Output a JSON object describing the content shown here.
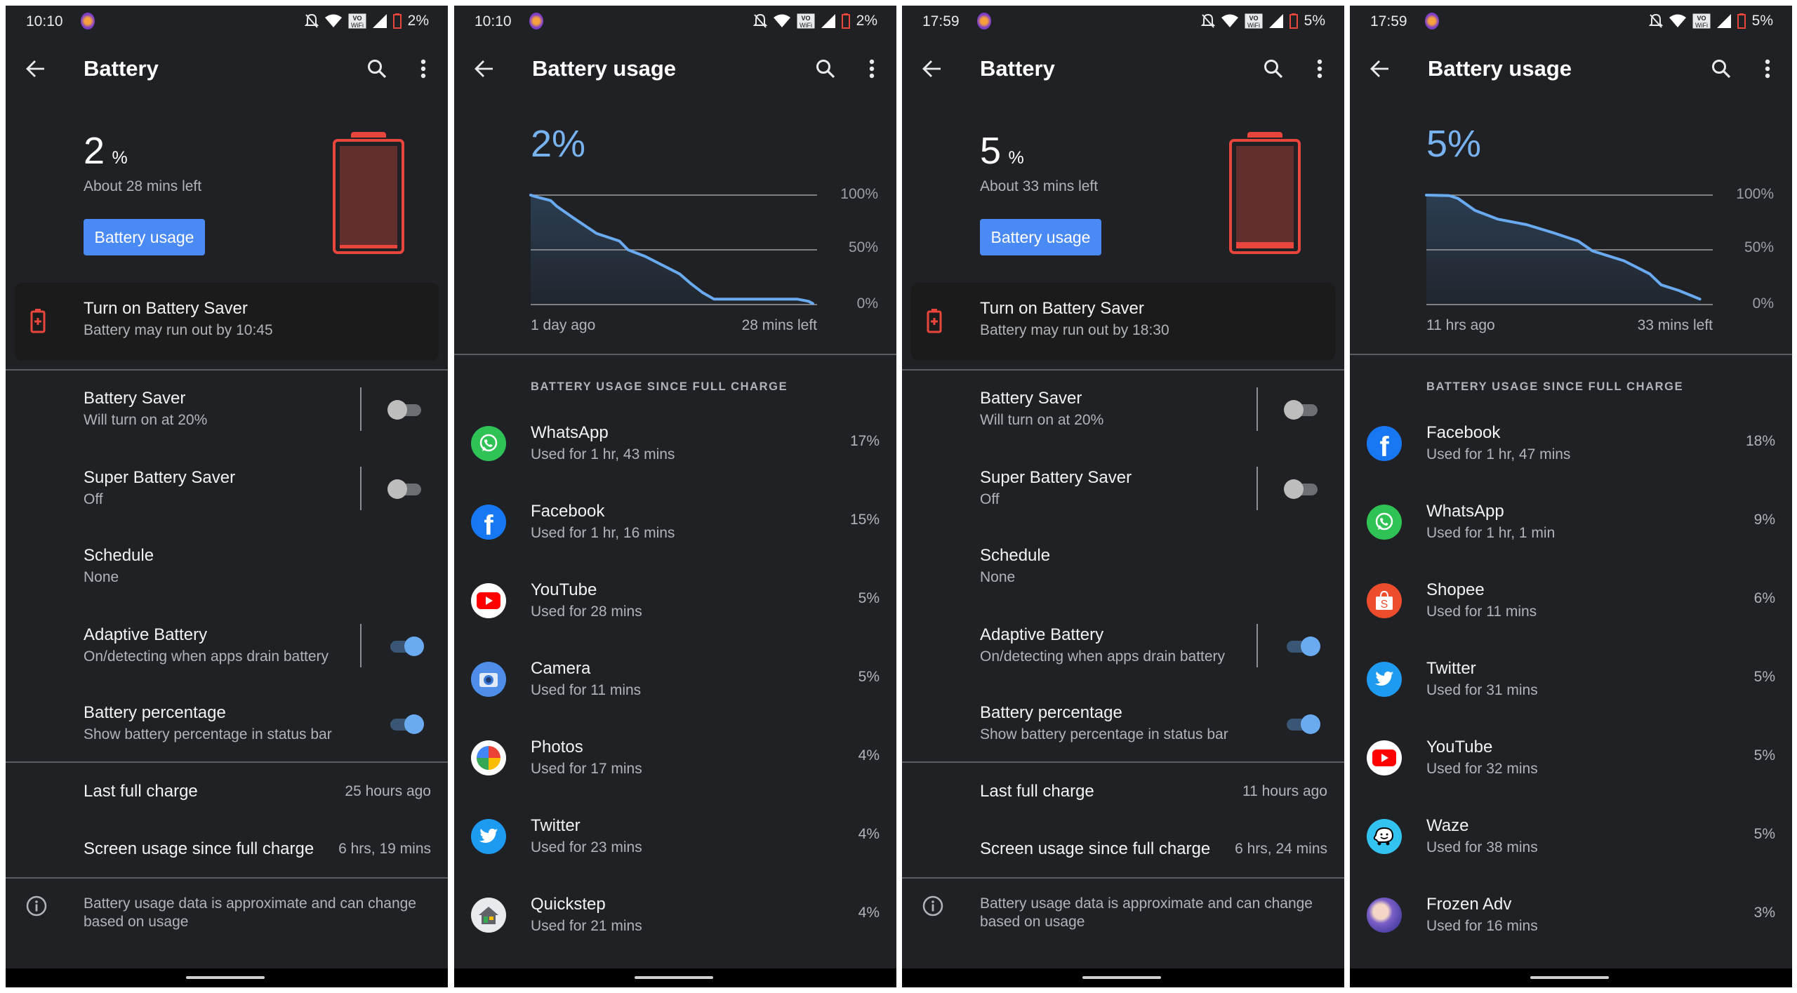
{
  "colors": {
    "background": "#202124",
    "accent_blue": "#4a8af4",
    "chart_line": "#6aaaf0",
    "battery_low_red": "#e8453c",
    "toggle_on_thumb": "#6aaaf0",
    "toggle_off_thumb": "#bdbdbd"
  },
  "screens": [
    {
      "type": "battery",
      "status": {
        "time": "10:10",
        "battery": "2%"
      },
      "header": {
        "title": "Battery"
      },
      "summary": {
        "level": "2",
        "unit": "%",
        "remaining": "About 28 mins left",
        "button": "Battery usage",
        "fill_percent": 2
      },
      "saver_card": {
        "title": "Turn on Battery Saver",
        "subtitle": "Battery may run out by 10:45"
      },
      "settings": [
        {
          "title": "Battery Saver",
          "subtitle": "Will turn on at 20%",
          "toggle": false,
          "divider": true
        },
        {
          "title": "Super Battery Saver",
          "subtitle": "Off",
          "toggle": false,
          "divider": true
        },
        {
          "title": "Schedule",
          "subtitle": "None",
          "toggle": null,
          "divider": false
        },
        {
          "title": "Adaptive Battery",
          "subtitle": "On/detecting when apps drain battery",
          "toggle": true,
          "divider": true
        },
        {
          "title": "Battery percentage",
          "subtitle": "Show battery percentage in status bar",
          "toggle": true,
          "divider": false
        }
      ],
      "stats": [
        {
          "label": "Last full charge",
          "value": "25 hours ago"
        },
        {
          "label": "Screen usage since full charge",
          "value": "6 hrs, 19 mins"
        }
      ],
      "info": {
        "line1": "Battery usage data is approximate and can change",
        "line2": "based on usage"
      }
    },
    {
      "type": "usage",
      "status": {
        "time": "10:10",
        "battery": "2%"
      },
      "header": {
        "title": "Battery usage"
      },
      "level": "2%",
      "chart_index": 0,
      "section_header": "BATTERY USAGE SINCE FULL CHARGE",
      "apps": [
        {
          "name": "WhatsApp",
          "usage": "Used for 1 hr, 43 mins",
          "percent": "17%",
          "icon": "whatsapp"
        },
        {
          "name": "Facebook",
          "usage": "Used for 1 hr, 16 mins",
          "percent": "15%",
          "icon": "facebook"
        },
        {
          "name": "YouTube",
          "usage": "Used for 28 mins",
          "percent": "5%",
          "icon": "youtube"
        },
        {
          "name": "Camera",
          "usage": "Used for 11 mins",
          "percent": "5%",
          "icon": "camera"
        },
        {
          "name": "Photos",
          "usage": "Used for 17 mins",
          "percent": "4%",
          "icon": "photos"
        },
        {
          "name": "Twitter",
          "usage": "Used for 23 mins",
          "percent": "4%",
          "icon": "twitter"
        },
        {
          "name": "Quickstep",
          "usage": "Used for 21 mins",
          "percent": "4%",
          "icon": "quickstep"
        }
      ]
    },
    {
      "type": "battery",
      "status": {
        "time": "17:59",
        "battery": "5%"
      },
      "header": {
        "title": "Battery"
      },
      "summary": {
        "level": "5",
        "unit": "%",
        "remaining": "About 33 mins left",
        "button": "Battery usage",
        "fill_percent": 5
      },
      "saver_card": {
        "title": "Turn on Battery Saver",
        "subtitle": "Battery may run out by 18:30"
      },
      "settings": [
        {
          "title": "Battery Saver",
          "subtitle": "Will turn on at 20%",
          "toggle": false,
          "divider": true
        },
        {
          "title": "Super Battery Saver",
          "subtitle": "Off",
          "toggle": false,
          "divider": true
        },
        {
          "title": "Schedule",
          "subtitle": "None",
          "toggle": null,
          "divider": false
        },
        {
          "title": "Adaptive Battery",
          "subtitle": "On/detecting when apps drain battery",
          "toggle": true,
          "divider": true
        },
        {
          "title": "Battery percentage",
          "subtitle": "Show battery percentage in status bar",
          "toggle": true,
          "divider": false
        }
      ],
      "stats": [
        {
          "label": "Last full charge",
          "value": "11 hours ago"
        },
        {
          "label": "Screen usage since full charge",
          "value": "6 hrs, 24 mins"
        }
      ],
      "info": {
        "line1": "Battery usage data is approximate and can change",
        "line2": "based on usage"
      }
    },
    {
      "type": "usage",
      "status": {
        "time": "17:59",
        "battery": "5%"
      },
      "header": {
        "title": "Battery usage"
      },
      "level": "5%",
      "chart_index": 1,
      "section_header": "BATTERY USAGE SINCE FULL CHARGE",
      "apps": [
        {
          "name": "Facebook",
          "usage": "Used for 1 hr, 47 mins",
          "percent": "18%",
          "icon": "facebook"
        },
        {
          "name": "WhatsApp",
          "usage": "Used for 1 hr, 1 min",
          "percent": "9%",
          "icon": "whatsapp"
        },
        {
          "name": "Shopee",
          "usage": "Used for 11 mins",
          "percent": "6%",
          "icon": "shopee"
        },
        {
          "name": "Twitter",
          "usage": "Used for 31 mins",
          "percent": "5%",
          "icon": "twitter"
        },
        {
          "name": "YouTube",
          "usage": "Used for 32 mins",
          "percent": "5%",
          "icon": "youtube"
        },
        {
          "name": "Waze",
          "usage": "Used for 38 mins",
          "percent": "5%",
          "icon": "waze"
        },
        {
          "name": "Frozen Adv",
          "usage": "Used for 16 mins",
          "percent": "3%",
          "icon": "frozen-adv"
        }
      ]
    }
  ],
  "chart_data": [
    {
      "type": "area",
      "ylim": [
        0,
        100
      ],
      "y_ticks": [
        "100%",
        "50%",
        "0%"
      ],
      "x_labels": [
        "1 day ago",
        "28 mins left"
      ],
      "grid": true,
      "x": [
        0,
        2.5,
        7,
        9,
        15,
        23,
        31,
        34,
        40,
        52,
        56,
        60,
        64,
        80,
        93,
        97,
        98.5
      ],
      "y": [
        100,
        98,
        95,
        90,
        79,
        65,
        58,
        50,
        44,
        28,
        19,
        11,
        5,
        5,
        5,
        3,
        1
      ]
    },
    {
      "type": "area",
      "ylim": [
        0,
        100
      ],
      "y_ticks": [
        "100%",
        "50%",
        "0%"
      ],
      "x_labels": [
        "11 hrs ago",
        "33 mins left"
      ],
      "grid": true,
      "x": [
        0,
        8,
        11,
        17,
        25,
        35,
        45,
        53,
        58,
        69,
        78,
        82,
        88,
        95.5
      ],
      "y": [
        100,
        99.5,
        97,
        86,
        78,
        73,
        65,
        58,
        49,
        40,
        28,
        18,
        13,
        5
      ]
    }
  ]
}
